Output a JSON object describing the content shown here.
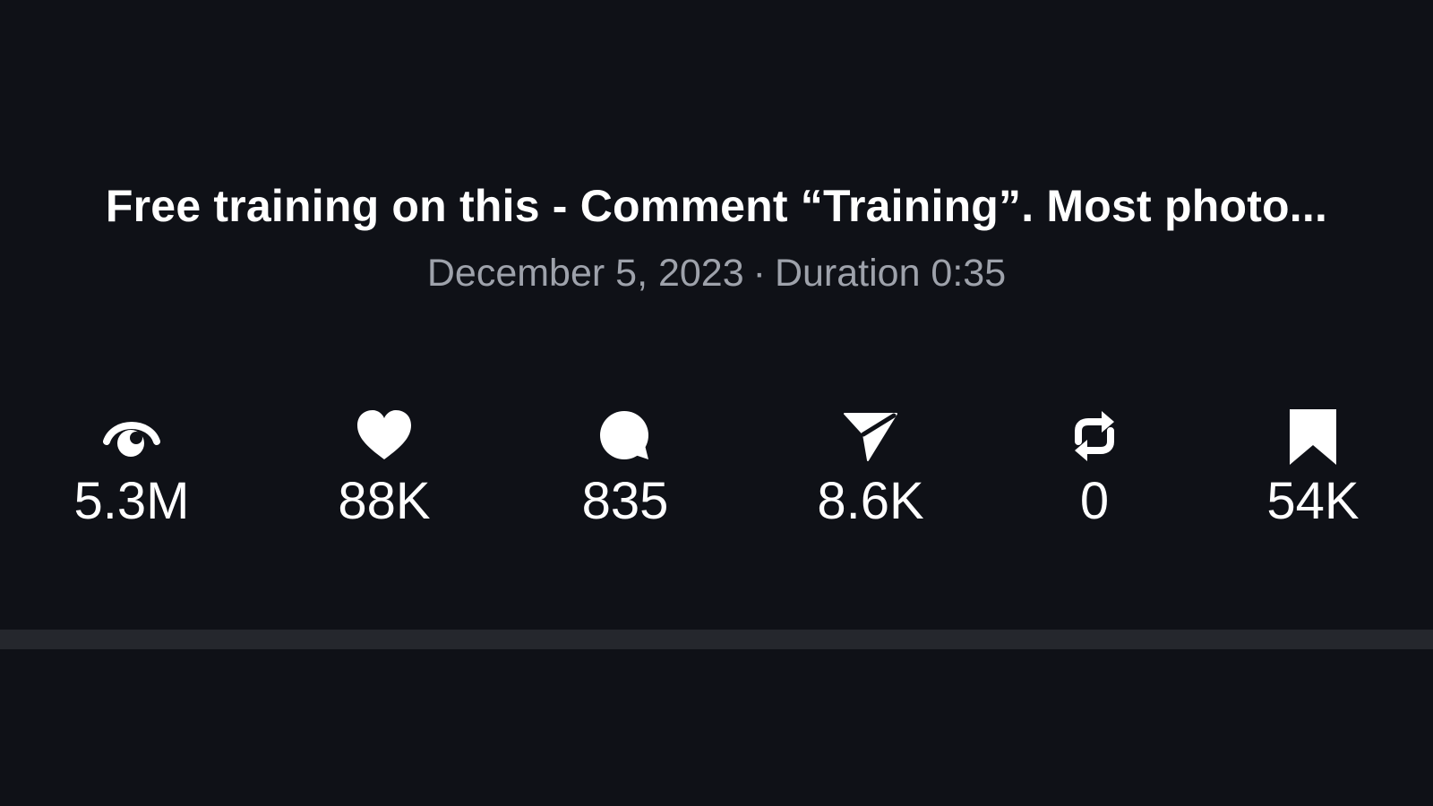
{
  "post": {
    "title": "Free training on this - Comment “Training”. Most photo...",
    "date": "December 5, 2023",
    "separator": "·",
    "duration": "Duration 0:35"
  },
  "stats": {
    "views": {
      "icon": "eye-icon",
      "value": "5.3M"
    },
    "likes": {
      "icon": "heart-icon",
      "value": "88K"
    },
    "comments": {
      "icon": "comment-bubble-icon",
      "value": "835"
    },
    "shares": {
      "icon": "send-icon",
      "value": "8.6K"
    },
    "reposts": {
      "icon": "repost-icon",
      "value": "0"
    },
    "saves": {
      "icon": "bookmark-icon",
      "value": "54K"
    }
  },
  "colors": {
    "background": "#0f1117",
    "primary_text": "#ffffff",
    "secondary_text": "#9ea2ab",
    "divider": "#25272d"
  }
}
